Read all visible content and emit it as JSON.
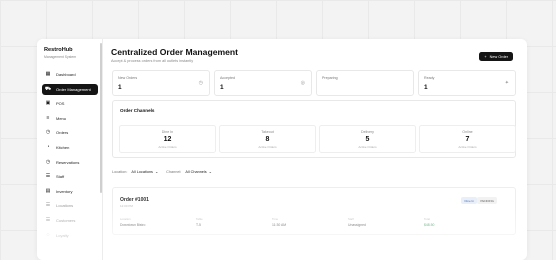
{
  "brand": {
    "name": "RestroHub",
    "subtitle": "Management System"
  },
  "sidebar": {
    "items": [
      {
        "label": "Dashboard",
        "icon": "grid-icon",
        "glyph": "▦",
        "active": false
      },
      {
        "label": "Order Management",
        "icon": "cart-icon",
        "glyph": "⛟",
        "active": true
      },
      {
        "label": "POS",
        "icon": "pos-icon",
        "glyph": "▣",
        "active": false
      },
      {
        "label": "Menu",
        "icon": "menu-icon",
        "glyph": "≡",
        "active": false
      },
      {
        "label": "Orders",
        "icon": "clock-icon",
        "glyph": "◷",
        "active": false
      },
      {
        "label": "Kitchen",
        "icon": "kitchen-icon",
        "glyph": "◔",
        "active": false
      },
      {
        "label": "Reservations",
        "icon": "calendar-icon",
        "glyph": "◷",
        "active": false
      },
      {
        "label": "Staff",
        "icon": "staff-icon",
        "glyph": "☰",
        "active": false
      },
      {
        "label": "Inventory",
        "icon": "box-icon",
        "glyph": "▤",
        "active": false
      },
      {
        "label": "Locations",
        "icon": "pin-icon",
        "glyph": "☰",
        "active": false
      },
      {
        "label": "Customers",
        "icon": "users-icon",
        "glyph": "☰",
        "active": false
      },
      {
        "label": "Loyalty",
        "icon": "star-icon",
        "glyph": "◌",
        "active": false
      }
    ]
  },
  "header": {
    "title": "Centralized Order Management",
    "subtitle": "Accept & process orders from all outlets instantly",
    "new_order_label": "New Order"
  },
  "stats": [
    {
      "label": "New Orders",
      "value": "1",
      "icon": "clock-icon",
      "glyph": "◷"
    },
    {
      "label": "Accepted",
      "value": "1",
      "icon": "check-icon",
      "glyph": "◎"
    },
    {
      "label": "Preparing",
      "value": "",
      "icon": "",
      "glyph": ""
    },
    {
      "label": "Ready",
      "value": "1",
      "icon": "sparkle-icon",
      "glyph": "✦"
    }
  ],
  "channels": {
    "title": "Order Channels",
    "items": [
      {
        "name": "Dine In",
        "count": "12",
        "sub": "Active Orders"
      },
      {
        "name": "Takeout",
        "count": "8",
        "sub": "Active Orders"
      },
      {
        "name": "Delivery",
        "count": "5",
        "sub": "Active Orders"
      },
      {
        "name": "Online",
        "count": "7",
        "sub": "Active Orders"
      }
    ]
  },
  "filters": {
    "location_label": "Location:",
    "location_value": "All Locations",
    "channel_label": "Channel:",
    "channel_value": "All Channels"
  },
  "order": {
    "id": "Order #1001",
    "time": "12:00 PM",
    "badge_channel": "Dine In",
    "badge_status": "PENDING",
    "fields": [
      {
        "label": "Location",
        "value": "Downtown Bistro"
      },
      {
        "label": "Table",
        "value": "T-5"
      },
      {
        "label": "Time",
        "value": "11:30 AM"
      },
      {
        "label": "Staff",
        "value": "Unassigned"
      },
      {
        "label": "Total",
        "value": "$48.50"
      }
    ]
  },
  "colors": {
    "accent": "#151515",
    "badge_blue": "#4a6fb0",
    "success": "#3a9a5b"
  }
}
